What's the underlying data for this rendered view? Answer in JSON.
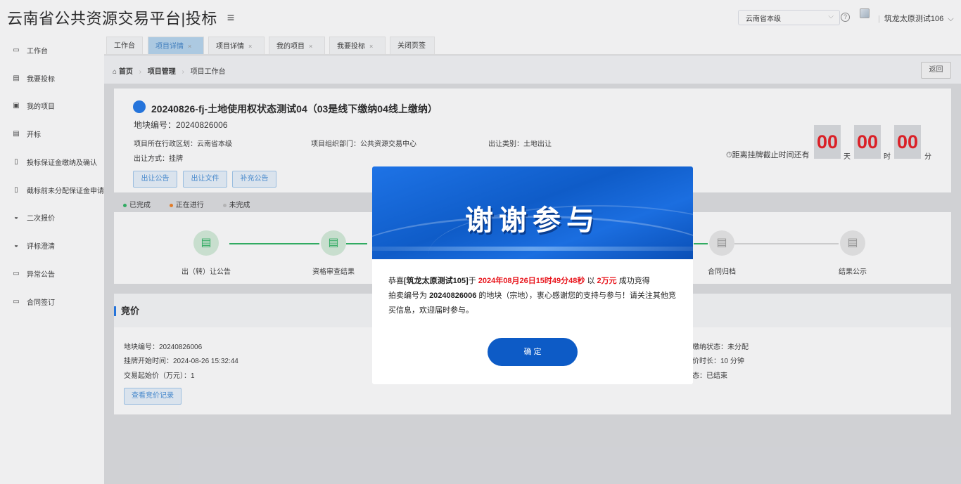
{
  "header": {
    "title": "云南省公共资源交易平台|投标",
    "menu_icon": "hamburger-icon",
    "region_select": "云南省本级",
    "user_name": "筑龙太原测试106"
  },
  "sidebar": {
    "items": [
      {
        "label": "工作台",
        "icon": "monitor-icon"
      },
      {
        "label": "我要投标",
        "icon": "doc-edit-icon"
      },
      {
        "label": "我的项目",
        "icon": "folder-icon"
      },
      {
        "label": "开标",
        "icon": "doc-edit-icon"
      },
      {
        "label": "投标保证金缴纳及确认",
        "icon": "file-icon"
      },
      {
        "label": "截标前未分配保证金申请",
        "icon": "file-icon"
      },
      {
        "label": "二次报价",
        "icon": "gavel-icon"
      },
      {
        "label": "评标澄清",
        "icon": "gavel-icon"
      },
      {
        "label": "异常公告",
        "icon": "monitor-icon"
      },
      {
        "label": "合同签订",
        "icon": "monitor-icon"
      }
    ]
  },
  "tabs": [
    {
      "label": "工作台"
    },
    {
      "label": "项目详情"
    },
    {
      "label": "项目详情"
    },
    {
      "label": "我的项目"
    },
    {
      "label": "我要投标"
    },
    {
      "label": "关闭页签"
    }
  ],
  "breadcrumb": {
    "home": "首页",
    "mid": "项目管理",
    "current": "项目工作台"
  },
  "back_label": "返回",
  "project": {
    "title": "20240826-fj-土地使用权状态测试04（03是线下缴纳04线上缴纳）",
    "plot_no": "地块编号：20240826006",
    "region": "项目所在行政区划：云南省本级",
    "org": "项目组织部门：公共资源交易中心",
    "category": "出让类别：土地出让",
    "method": "出让方式：挂牌",
    "buttons": [
      "出让公告",
      "出让文件",
      "补充公告"
    ],
    "countdown_label": "距离挂牌截止时间还有",
    "countdown": [
      {
        "value": "00",
        "unit": "天"
      },
      {
        "value": "00",
        "unit": "时"
      },
      {
        "value": "00",
        "unit": "分"
      }
    ]
  },
  "legend": {
    "done": "已完成",
    "ongoing": "正在进行",
    "todo": "未完成"
  },
  "colors": {
    "done": "#27b25e",
    "ongoing": "#f07c1c",
    "todo": "#bbbbbb",
    "accent": "#1a73e8",
    "countdown": "#e8141b"
  },
  "steps": [
    {
      "label": "出（转）让公告",
      "status": "done"
    },
    {
      "label": "资格审查结果",
      "status": "done"
    },
    {
      "label": "合同归档",
      "status": "todo"
    },
    {
      "label": "结果公示",
      "status": "todo"
    }
  ],
  "bidding": {
    "title": "竞价",
    "plot_no": "地块编号：20240826006",
    "start_time": "挂牌开始时间：2024-08-26 15:32:44",
    "start_price": "交易起始价（万元）：1",
    "deposit_status": "缴纳状态：未分配",
    "duration": "价时长：10 分钟",
    "state": "态：已结束",
    "records_button": "查看竞价记录"
  },
  "modal": {
    "heading": "谢谢参与",
    "pre": "恭喜",
    "winner": "[筑龙太原测试105]",
    "at": "于",
    "time": "2024年08月26日15时49分48秒",
    "with": "以",
    "amount": "2万元",
    "win_text": "成功竞得",
    "line2_pre": "拍卖编号为",
    "auction_no": "20240826006",
    "line2_post": "的地块（宗地），衷心感谢您的支持与参与！请关注其他竞买信息，欢迎届时参与。",
    "ok": "确 定"
  }
}
